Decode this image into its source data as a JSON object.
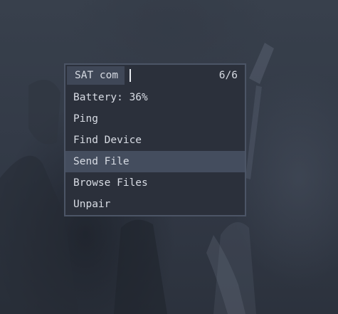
{
  "prompt": {
    "label": "SAT com",
    "input_value": "",
    "counter": "6/6"
  },
  "menu": {
    "items": [
      {
        "label": "Battery: 36%"
      },
      {
        "label": "Ping"
      },
      {
        "label": "Find Device"
      },
      {
        "label": "Send File",
        "selected": true
      },
      {
        "label": "Browse Files"
      },
      {
        "label": "Unpair"
      }
    ]
  },
  "colors": {
    "background": "#343b47",
    "panel": "#2b303b",
    "border": "#4c5566",
    "selected_row": "#444d5e",
    "text": "#d8dce4"
  }
}
